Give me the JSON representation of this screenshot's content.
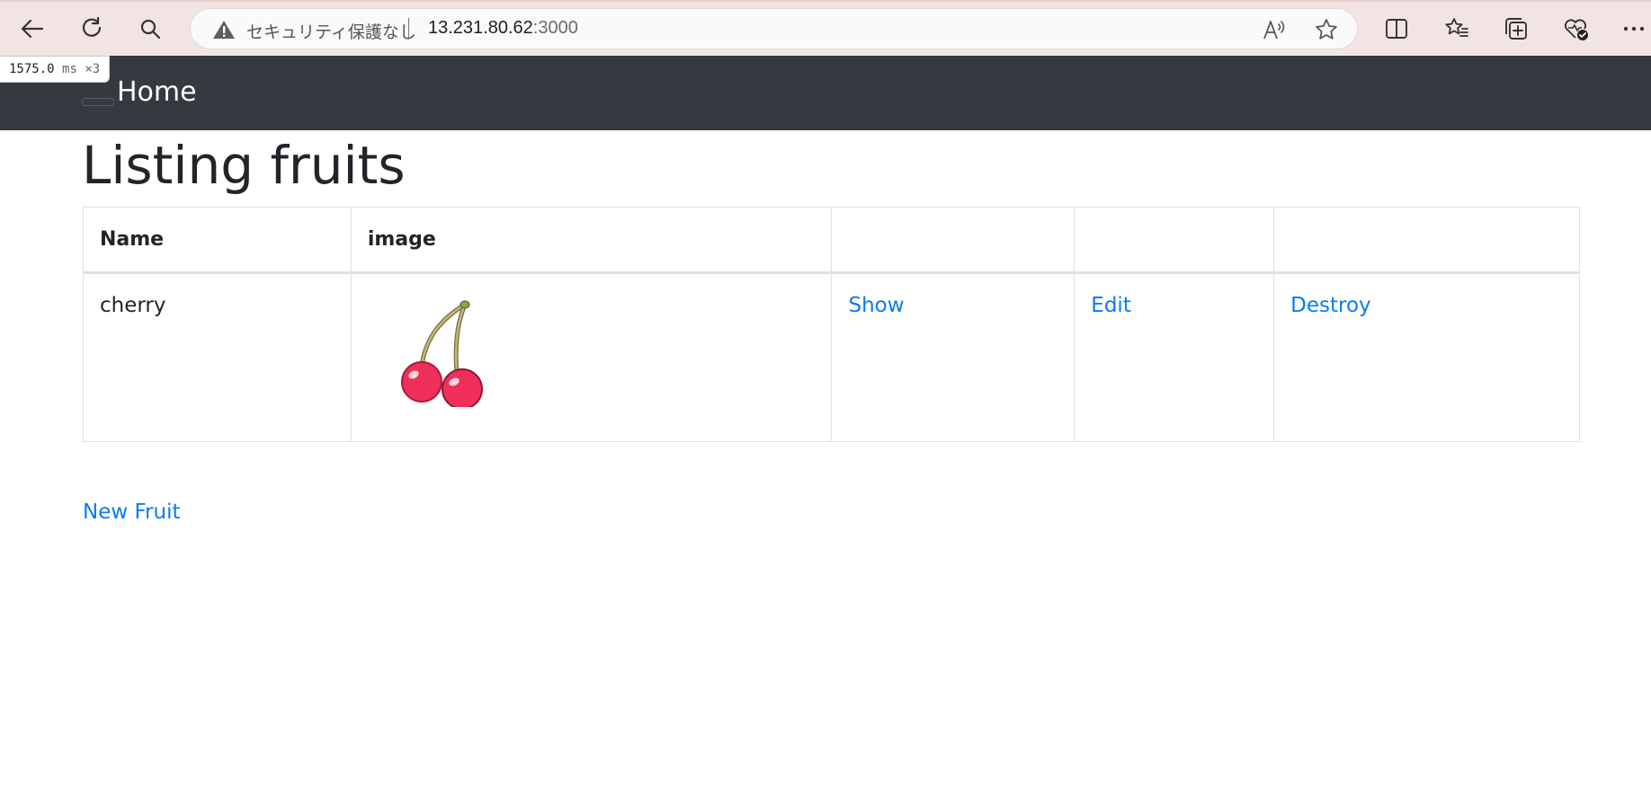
{
  "browser": {
    "security_label": "セキュリティ保護なし",
    "url_host": "13.231.80.62",
    "url_port": ":3000",
    "icons": [
      "back-icon",
      "reload-icon",
      "search-icon",
      "warning-icon",
      "read-aloud-icon",
      "favorite-star-icon",
      "split-screen-icon",
      "favorites-icon",
      "collections-icon",
      "browser-essentials-icon",
      "more-icon"
    ]
  },
  "timing": {
    "value": "1575.0",
    "unit": "ms",
    "count": "×3"
  },
  "navbar": {
    "brand": "Home",
    "background": "#343a40"
  },
  "page": {
    "title": "Listing fruits"
  },
  "table": {
    "headers": [
      "Name",
      "image",
      "",
      "",
      ""
    ],
    "rows": [
      {
        "name": "cherry",
        "image_icon": "cherry-image",
        "show": "Show",
        "edit": "Edit",
        "destroy": "Destroy"
      }
    ]
  },
  "links": {
    "new_fruit": "New Fruit",
    "color": "#0b7bf0"
  }
}
